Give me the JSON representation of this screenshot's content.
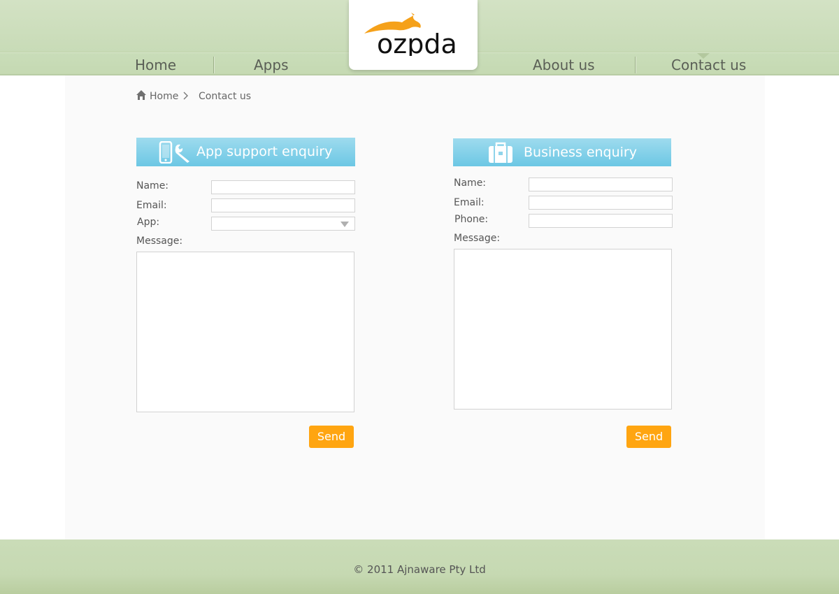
{
  "logo": {
    "text": "ozpda",
    "brand_color": "#f5a11a"
  },
  "nav": {
    "items": [
      {
        "label": "Home"
      },
      {
        "label": "Apps"
      },
      {
        "label": "About us"
      },
      {
        "label": "Contact us"
      }
    ],
    "active": "Contact us"
  },
  "breadcrumb": {
    "home": "Home",
    "current": "Contact us"
  },
  "app_support": {
    "title": "App support enquiry",
    "name_label": "Name:",
    "email_label": "Email:",
    "app_label": "App:",
    "message_label": "Message:",
    "app_selected": "",
    "send": "Send"
  },
  "business": {
    "title": "Business enquiry",
    "name_label": "Name:",
    "email_label": "Email:",
    "phone_label": "Phone:",
    "message_label": "Message:",
    "send": "Send"
  },
  "footer": {
    "copyright": "©  2011 Ajnaware Pty Ltd"
  },
  "colors": {
    "header_green": "#c8dbb7",
    "form_header_blue": "#6cc7e4",
    "send_orange": "#ffa511"
  }
}
